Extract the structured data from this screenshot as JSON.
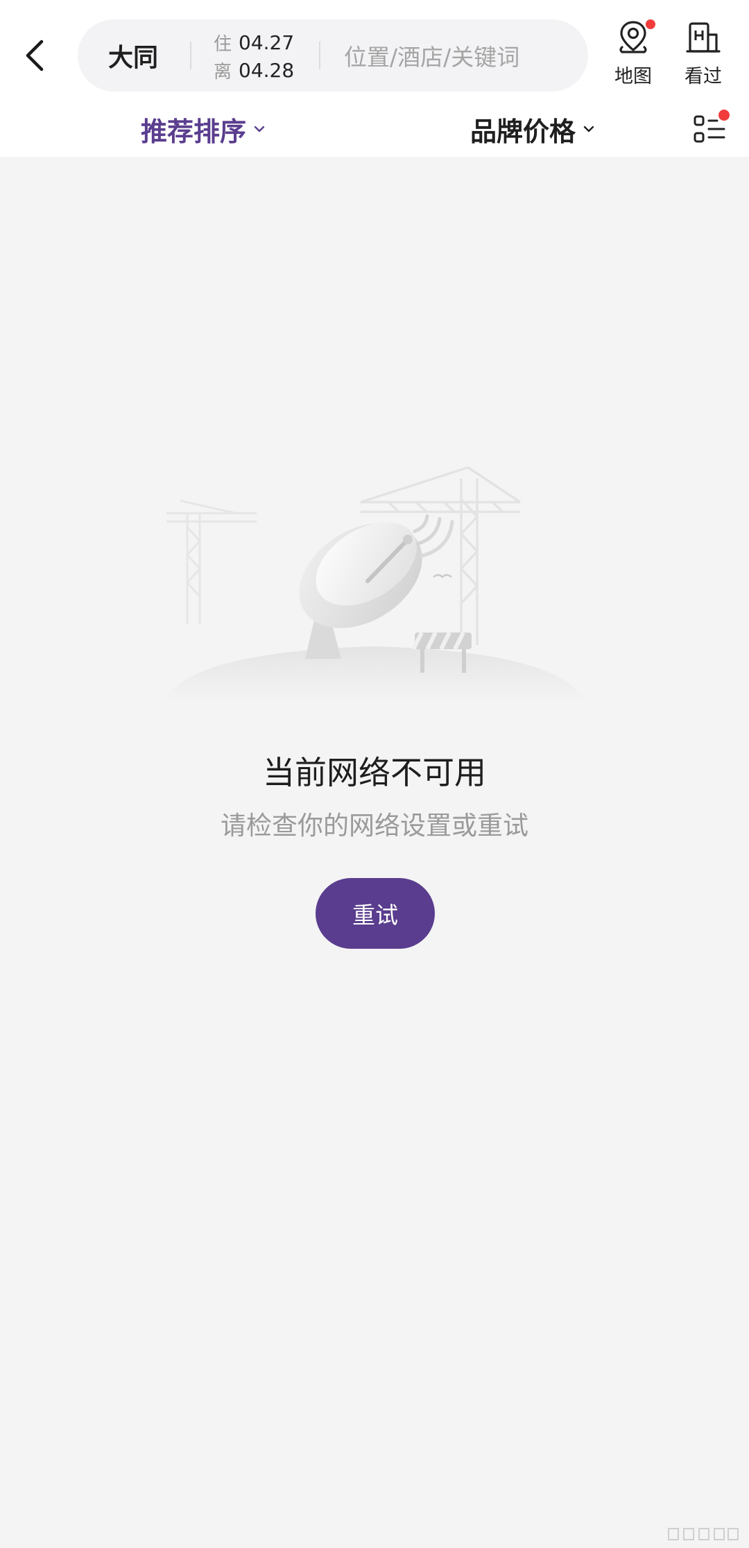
{
  "header": {
    "city": "大同",
    "checkin_tag": "住",
    "checkin_date": "04.27",
    "checkout_tag": "离",
    "checkout_date": "04.28",
    "keyword_placeholder": "位置/酒店/关键词",
    "map_label": "地图",
    "history_label": "看过"
  },
  "filters": {
    "sort_label": "推荐排序",
    "brand_price_label": "品牌价格"
  },
  "empty_state": {
    "title": "当前网络不可用",
    "subtitle": "请检查你的网络设置或重试",
    "retry_label": "重试"
  },
  "colors": {
    "accent": "#5a3d8e",
    "badge": "#f23c3c",
    "background": "#f4f4f4"
  },
  "icons": [
    "back-arrow-icon",
    "map-pin-icon",
    "hotel-icon",
    "filter-list-icon",
    "chevron-down-icon"
  ]
}
